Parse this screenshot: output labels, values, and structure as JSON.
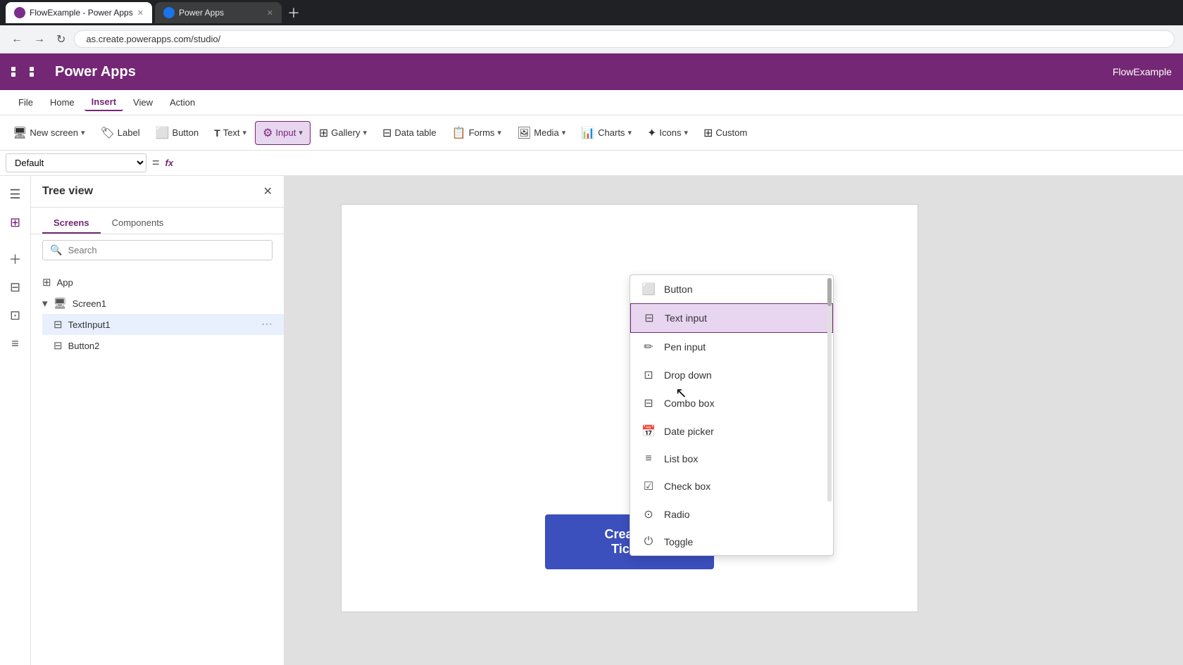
{
  "browser": {
    "tabs": [
      {
        "id": "tab1",
        "label": "FlowExample - Power Apps",
        "active": true,
        "favicon_color": "#7b2d8b"
      },
      {
        "id": "tab2",
        "label": "Power Apps",
        "active": false,
        "favicon_color": "#7b2d8b"
      }
    ],
    "address": "as.create.powerapps.com/studio/"
  },
  "app": {
    "title": "Power Apps",
    "header_right": "FlowExample"
  },
  "menu": {
    "items": [
      "File",
      "Home",
      "Insert",
      "View",
      "Action"
    ],
    "active": "Insert"
  },
  "toolbar": {
    "items": [
      {
        "id": "new-screen",
        "label": "New screen",
        "icon": "🖥",
        "has_chevron": true
      },
      {
        "id": "label",
        "label": "Label",
        "icon": "🏷",
        "has_chevron": false
      },
      {
        "id": "button",
        "label": "Button",
        "icon": "⬜",
        "has_chevron": false
      },
      {
        "id": "text",
        "label": "Text",
        "icon": "T",
        "has_chevron": true
      },
      {
        "id": "input",
        "label": "Input",
        "icon": "⚙",
        "has_chevron": true,
        "active": true
      },
      {
        "id": "gallery",
        "label": "Gallery",
        "icon": "⊞",
        "has_chevron": true
      },
      {
        "id": "data-table",
        "label": "Data table",
        "icon": "⊟",
        "has_chevron": false
      },
      {
        "id": "forms",
        "label": "Forms",
        "icon": "📋",
        "has_chevron": true
      },
      {
        "id": "media",
        "label": "Media",
        "icon": "🖼",
        "has_chevron": true
      },
      {
        "id": "charts",
        "label": "Charts",
        "icon": "📊",
        "has_chevron": true
      },
      {
        "id": "icons",
        "label": "Icons",
        "icon": "✦",
        "has_chevron": true
      },
      {
        "id": "custom",
        "label": "Custom",
        "icon": "⊞",
        "has_chevron": false
      }
    ]
  },
  "formula_bar": {
    "select_value": "Default",
    "fx_label": "fx"
  },
  "tree_panel": {
    "title": "Tree view",
    "tabs": [
      "Screens",
      "Components"
    ],
    "active_tab": "Screens",
    "search_placeholder": "Search",
    "items": [
      {
        "id": "app",
        "label": "App",
        "icon": "⊞",
        "indent": 0
      },
      {
        "id": "screen1",
        "label": "Screen1",
        "icon": "🖥",
        "indent": 0,
        "expanded": true
      },
      {
        "id": "textinput1",
        "label": "TextInput1",
        "icon": "⊟",
        "indent": 1,
        "selected": true
      },
      {
        "id": "button2",
        "label": "Button2",
        "icon": "⊟",
        "indent": 1
      }
    ]
  },
  "dropdown": {
    "items": [
      {
        "id": "button",
        "label": "Button",
        "icon": "⬜"
      },
      {
        "id": "text-input",
        "label": "Text input",
        "icon": "⊟",
        "highlighted": true
      },
      {
        "id": "pen-input",
        "label": "Pen input",
        "icon": "✏"
      },
      {
        "id": "drop-down",
        "label": "Drop down",
        "icon": "⊡"
      },
      {
        "id": "combo-box",
        "label": "Combo box",
        "icon": "⊟"
      },
      {
        "id": "date-picker",
        "label": "Date picker",
        "icon": "📅"
      },
      {
        "id": "list-box",
        "label": "List box",
        "icon": "≡"
      },
      {
        "id": "check-box",
        "label": "Check box",
        "icon": "☑"
      },
      {
        "id": "radio",
        "label": "Radio",
        "icon": "⊙"
      },
      {
        "id": "toggle",
        "label": "Toggle",
        "icon": "⏻"
      }
    ]
  },
  "canvas": {
    "button_label": "Create a Ticket"
  },
  "sidebar_icons": [
    "☰",
    "⊞",
    "＋",
    "⊟",
    "⊡",
    "≡"
  ],
  "colors": {
    "purple": "#742774",
    "blue_btn": "#3b4fbd",
    "highlight_bg": "#e8d5f0",
    "highlight_border": "#742774"
  }
}
